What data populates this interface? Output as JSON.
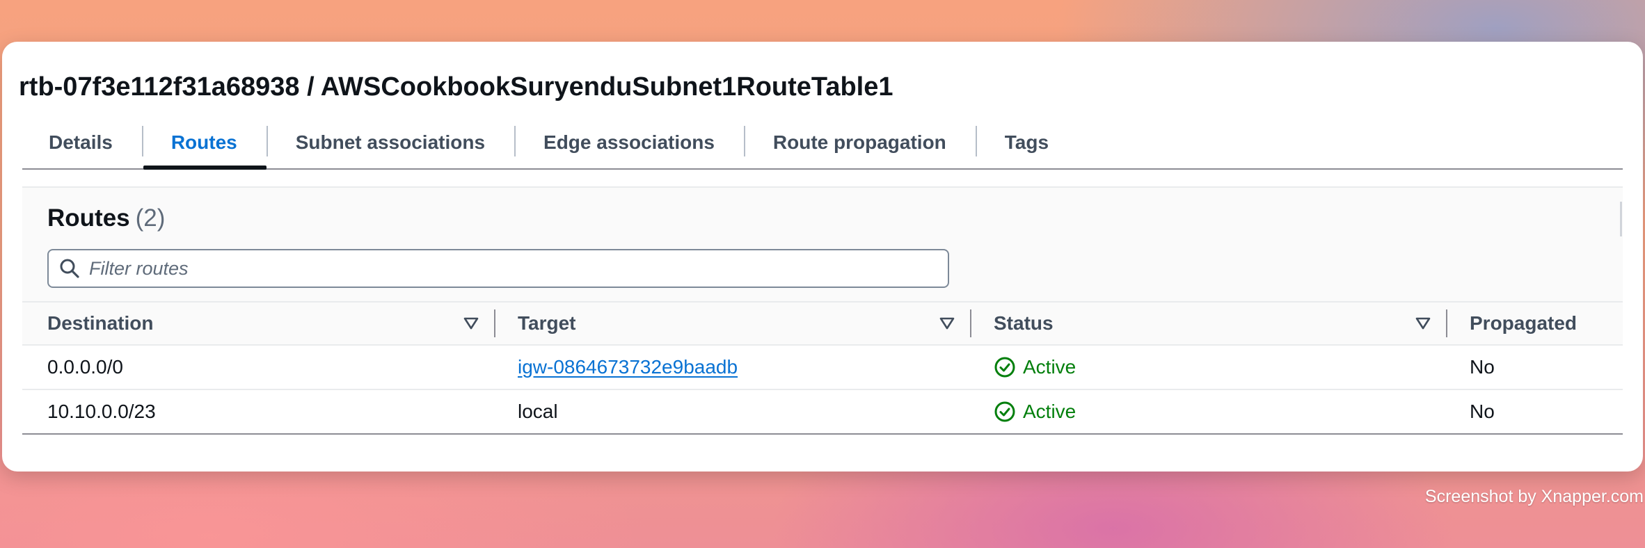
{
  "page": {
    "title": "rtb-07f3e112f31a68938 / AWSCookbookSuryenduSubnet1RouteTable1"
  },
  "tabs": [
    {
      "label": "Details",
      "active": false
    },
    {
      "label": "Routes",
      "active": true
    },
    {
      "label": "Subnet associations",
      "active": false
    },
    {
      "label": "Edge associations",
      "active": false
    },
    {
      "label": "Route propagation",
      "active": false
    },
    {
      "label": "Tags",
      "active": false
    }
  ],
  "routes": {
    "heading": "Routes",
    "count": "(2)",
    "filter_placeholder": "Filter routes",
    "filter_value": "",
    "columns": [
      "Destination",
      "Target",
      "Status",
      "Propagated"
    ],
    "rows": [
      {
        "destination": "0.0.0.0/0",
        "target": "igw-0864673732e9baadb",
        "target_is_link": true,
        "status": "Active",
        "propagated": "No"
      },
      {
        "destination": "10.10.0.0/23",
        "target": "local",
        "target_is_link": false,
        "status": "Active",
        "propagated": "No"
      }
    ]
  },
  "footer": {
    "credit": "Screenshot by Xnapper.com"
  },
  "colors": {
    "accent": "#0972d3",
    "success": "#037f0c",
    "text": "#0f141a"
  },
  "icons": {
    "filter": "search-icon",
    "sort": "sort-caret-down-icon",
    "status": "status-success-check-icon"
  }
}
